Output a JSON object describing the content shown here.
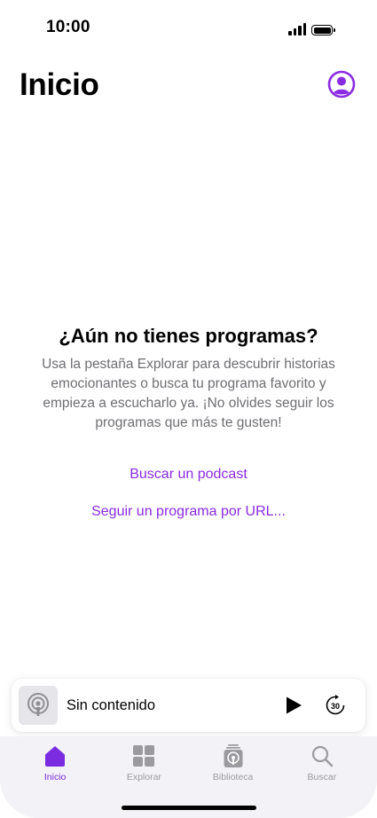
{
  "status_bar": {
    "time": "10:00"
  },
  "header": {
    "title": "Inicio",
    "account_icon": "person-circle-icon"
  },
  "empty_state": {
    "title": "¿Aún no tienes programas?",
    "description": "Usa la pestaña Explorar para descubrir historias emocionantes o busca tu programa favorito y empieza a escucharlo ya. ¡No olvides seguir los programas que más te gusten!",
    "search_link": "Buscar un podcast",
    "url_link": "Seguir un programa por URL..."
  },
  "mini_player": {
    "title": "Sin contenido",
    "artwork_icon": "podcast-icon",
    "play_icon": "play-icon",
    "skip_icon": "skip-forward-30-icon",
    "skip_label": "30"
  },
  "tab_bar": {
    "tabs": [
      {
        "label": "Inicio",
        "icon": "house-icon",
        "active": true
      },
      {
        "label": "Explorar",
        "icon": "grid-icon",
        "active": false
      },
      {
        "label": "Biblioteca",
        "icon": "library-icon",
        "active": false
      },
      {
        "label": "Buscar",
        "icon": "search-icon",
        "active": false
      }
    ]
  },
  "colors": {
    "accent": "#8a2be2",
    "text_secondary": "#6e6e73",
    "tab_inactive": "#9a9a9f",
    "tab_bar_bg": "#f2f2f7"
  }
}
